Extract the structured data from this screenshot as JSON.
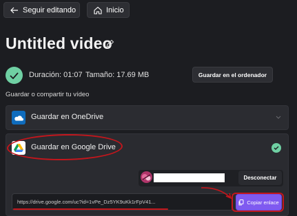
{
  "toolbar": {
    "back_label": "Seguir editando",
    "home_label": "Inicio"
  },
  "video": {
    "title": "Untitled video",
    "duration": "Duración: 01:07",
    "size": "Tamaño: 17.69 MB"
  },
  "actions": {
    "save_pc": "Guardar en el ordenador"
  },
  "share": {
    "section_label": "Guardar o compartir tu vídeo",
    "onedrive_label": "Guardar en OneDrive",
    "gdrive_label": "Guardar en Google Drive",
    "disconnect_label": "Desconectar",
    "link_url": "https://drive.google.com/uc?id=1vPe_Dz5YK9uKk1rFpV41...",
    "copy_label": "Copiar enlace"
  },
  "colors": {
    "background": "#1c1d21",
    "accent": "#7f5af0",
    "success": "#6fd0a3",
    "annotation": "#c4161c"
  }
}
